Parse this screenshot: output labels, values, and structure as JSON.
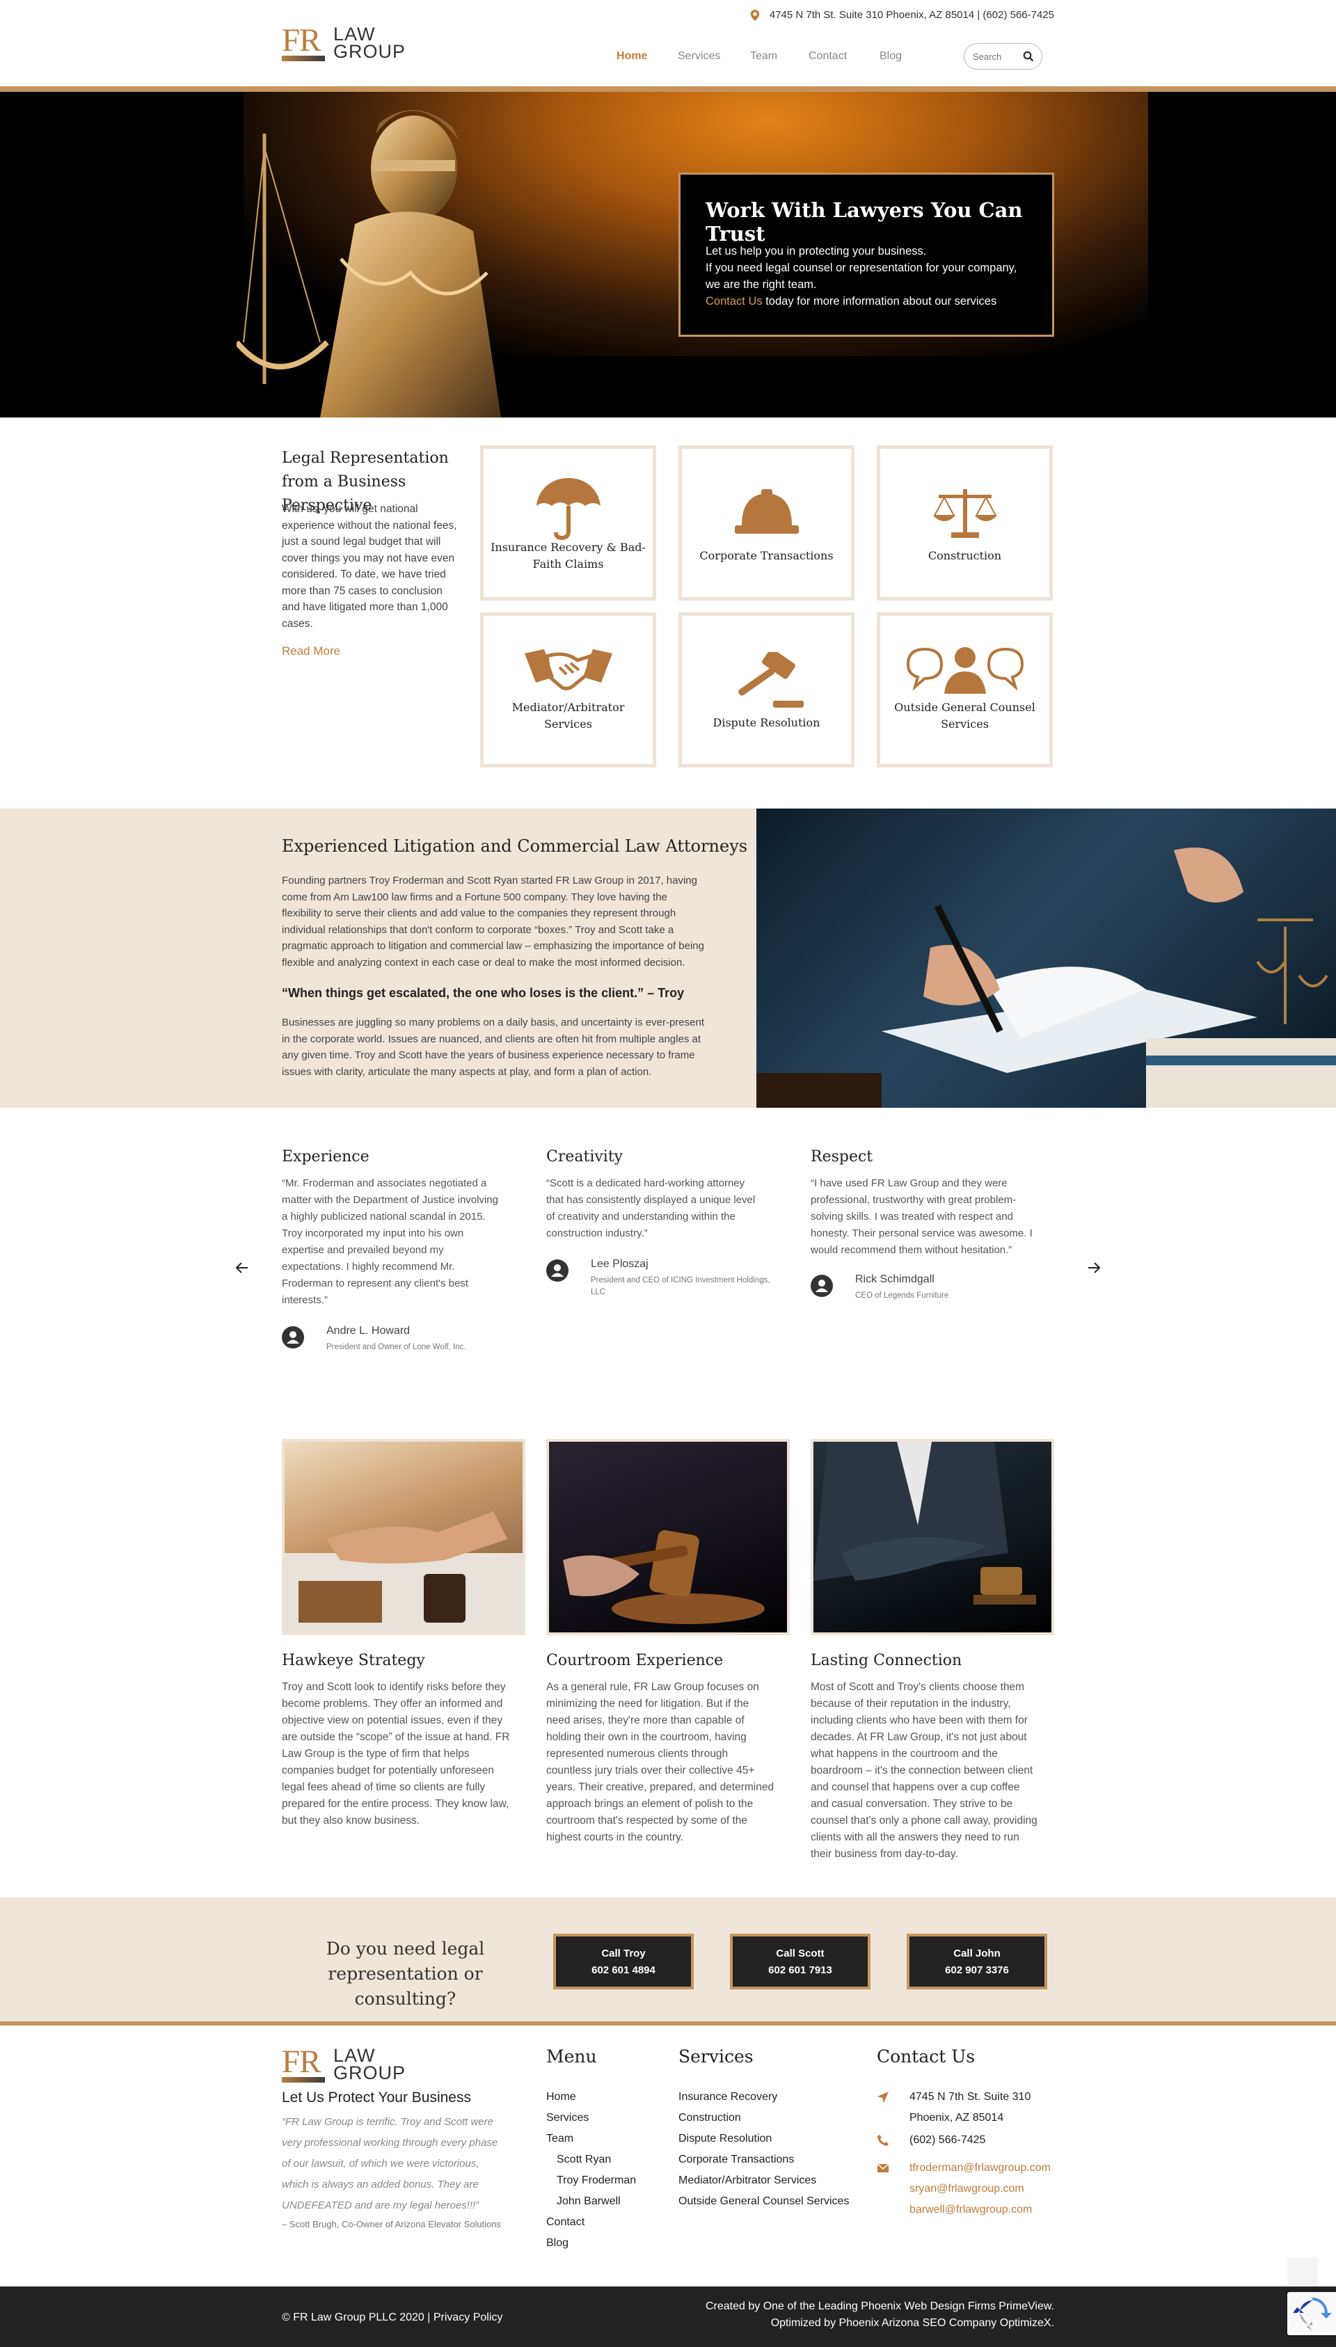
{
  "header": {
    "logo": {
      "fr": "FR",
      "law": "LAW",
      "group": "GROUP"
    },
    "address": "4745 N 7th St. Suite 310 Phoenix, AZ 85014 | (602) 566-7425",
    "nav": [
      "Home",
      "Services",
      "Team",
      "Contact",
      "Blog"
    ],
    "search_placeholder": "Search"
  },
  "hero": {
    "title": "Work With Lawyers You Can Trust",
    "line1": "Let us help you in protecting your business.",
    "line2": "If you need legal counsel or representation for your company,",
    "line3": "we are the right team.",
    "contact_link": "Contact Us",
    "line4": " today for more information about our services"
  },
  "intro": {
    "title": "Legal Representation from a Business Perspective",
    "body": "With us, you will get national experience without the national fees, just a sound legal budget that will cover things you may not have even considered. To date, we have tried more than 75 cases to conclusion and have litigated more than 1,000 cases.",
    "read_more": "Read More"
  },
  "services": [
    {
      "label": "Insurance Recovery & Bad-Faith Claims",
      "icon": "umbrella-icon"
    },
    {
      "label": "Corporate Transactions",
      "icon": "hardhat-icon"
    },
    {
      "label": "Construction",
      "icon": "scales-icon"
    },
    {
      "label": "Mediator/Arbitrator Services",
      "icon": "handshake-icon"
    },
    {
      "label": "Dispute Resolution",
      "icon": "gavel-icon"
    },
    {
      "label": "Outside General Counsel Services",
      "icon": "counsel-icon"
    }
  ],
  "attorneys": {
    "title": "Experienced Litigation and Commercial Law Attorneys",
    "p1": [
      "Founding partners Troy Froderman and Scott Ryan started FR Law Group in 2017, having",
      "come from Am Law100 law firms and a Fortune 500 company. They love having the",
      "flexibility to serve their clients and add value to the companies they represent through",
      "individual relationships that don't conform to corporate “boxes.” Troy and Scott take a",
      "pragmatic approach to litigation and commercial law – emphasizing the importance of being",
      "flexible and analyzing context in each case or deal to make the most informed decision."
    ],
    "quote": "“When things get escalated, the one who loses is the client.” – Troy",
    "p2": [
      "Businesses are juggling so many problems on a daily basis, and uncertainty is ever-present",
      "in the corporate world. Issues are nuanced, and clients are often hit from multiple angles at",
      "any given time. Troy and Scott have the years of business experience necessary to frame",
      "issues with clarity, articulate the many aspects at play, and form a plan of action."
    ]
  },
  "testimonials": [
    {
      "title": "Experience",
      "lines": [
        "“Mr. Froderman and associates negotiated a",
        "matter with the Department of Justice involving",
        "a highly publicized national scandal in 2015.",
        "Troy incorporated my input into his own",
        "expertise and prevailed beyond my",
        "expectations. I highly recommend Mr.",
        "Froderman to represent any client's best",
        "interests.”"
      ],
      "name": "Andre L. Howard",
      "role": "President and Owner of Lone Wolf, Inc."
    },
    {
      "title": "Creativity",
      "lines": [
        "“Scott is a dedicated hard-working attorney",
        "that has consistently displayed a unique level",
        "of creativity and understanding within the",
        "construction industry.”"
      ],
      "name": "Lee Ploszaj",
      "role": "President and CEO of ICING Investment Holdings, LLC"
    },
    {
      "title": "Respect",
      "lines": [
        "“I have used FR Law Group and they were",
        "professional, trustworthy with great problem-",
        "solving skills. I was treated with respect and",
        "honesty. Their personal service was awesome. I",
        "would recommend them without hesitation.”"
      ],
      "name": "Rick Schimdgall",
      "role": "CEO of Legends Furniture"
    }
  ],
  "features": [
    {
      "title": "Hawkeye Strategy",
      "lines": [
        "Troy and Scott look to identify risks before they",
        "become problems. They offer an informed and",
        "objective view on potential issues, even if they",
        "are outside the “scope” of the issue at hand. FR",
        "Law Group is the type of firm that helps",
        "companies budget for potentially unforeseen",
        "legal fees ahead of time so clients are fully",
        "prepared for the entire process. They know law,",
        "but they also know business."
      ]
    },
    {
      "title": "Courtroom Experience",
      "lines": [
        "As a general rule, FR Law Group focuses on",
        "minimizing the need for litigation. But if the",
        "need arises, they're more than capable of",
        "holding their own in the courtroom, having",
        "represented numerous clients through",
        "countless jury trials over their collective 45+",
        "years. Their creative, prepared, and determined",
        "approach brings an element of polish to the",
        "courtroom that's respected by some of the",
        "highest courts in the country."
      ]
    },
    {
      "title": "Lasting Connection",
      "lines": [
        "Most of Scott and Troy's clients choose them",
        "because of their reputation in the industry,",
        "including clients who have been with them for",
        "decades. At FR Law Group, it's not just about",
        "what happens in the courtroom and the",
        "boardroom – it's the connection between client",
        "and counsel that happens over a cup coffee",
        "and casual conversation. They strive to be",
        "counsel that's only a phone call away, providing",
        "clients with all the answers they need to run",
        "their business from day-to-day."
      ]
    }
  ],
  "cta": {
    "question_line1": "Do you need legal",
    "question_line2": "representation or consulting?",
    "buttons": [
      {
        "name": "Call Troy",
        "phone": "602 601 4894"
      },
      {
        "name": "Call Scott",
        "phone": "602 601 7913"
      },
      {
        "name": "Call John",
        "phone": "602 907 3376"
      }
    ]
  },
  "footer": {
    "tagline": "Let Us Protect Your Business",
    "testimonial_lines": [
      "“FR Law Group is terrific. Troy and Scott were",
      "very professional working through every phase",
      "of our lawsuit, of which we were victorious,",
      "which is always an added bonus. They are",
      "UNDEFEATED and are my legal heroes!!!”"
    ],
    "testimonial_by": "– Scott Brugh, Co-Owner of Arizona Elevator Solutions",
    "menu_title": "Menu",
    "menu": [
      "Home",
      "Services",
      "Team"
    ],
    "team": [
      "Scott Ryan",
      "Troy Froderman",
      "John Barwell"
    ],
    "menu_after": [
      "Contact",
      "Blog"
    ],
    "services_title": "Services",
    "services": [
      "Insurance Recovery",
      "Construction",
      "Dispute Resolution",
      "Corporate Transactions",
      "Mediator/Arbitrator Services",
      "Outside General Counsel Services"
    ],
    "contact_title": "Contact Us",
    "address1": "4745 N 7th St. Suite 310",
    "address2": "Phoenix, AZ 85014",
    "phone": "(602) 566-7425",
    "emails": [
      "tfroderman@frlawgroup.com",
      "sryan@frlawgroup.com",
      "barwell@frlawgroup.com"
    ]
  },
  "bottom": {
    "copyright": "© FR Law Group PLLC 2020 | ",
    "privacy": "Privacy Policy",
    "credit1": "Created by One of the Leading Phoenix Web Design Firms PrimeView.",
    "credit2": "Optimized by Phoenix Arizona SEO Company OptimizeX."
  },
  "colors": {
    "accent": "#c5955f",
    "link": "#c37b3a",
    "beige": "#efe5d8",
    "dark": "#222222"
  }
}
